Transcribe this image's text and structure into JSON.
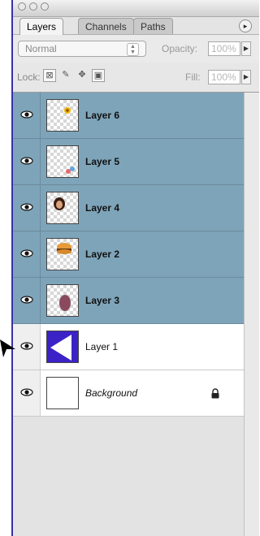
{
  "tabs": [
    {
      "label": "Layers",
      "active": true
    },
    {
      "label": "Channels",
      "active": false
    },
    {
      "label": "Paths",
      "active": false
    }
  ],
  "options": {
    "blend_mode": "Normal",
    "opacity_label": "Opacity:",
    "opacity_value": "100%",
    "lock_label": "Lock:",
    "fill_label": "Fill:",
    "fill_value": "100%"
  },
  "layers": [
    {
      "name": "Layer 6",
      "visible": true,
      "selected": true
    },
    {
      "name": "Layer 5",
      "visible": true,
      "selected": true
    },
    {
      "name": "Layer 4",
      "visible": true,
      "selected": true
    },
    {
      "name": "Layer 2",
      "visible": true,
      "selected": true
    },
    {
      "name": "Layer 3",
      "visible": true,
      "selected": true
    },
    {
      "name": "Layer 1",
      "visible": true,
      "selected": false
    },
    {
      "name": "Background",
      "visible": true,
      "selected": false,
      "locked": true
    }
  ],
  "colors": {
    "selection": "#7ea4b9",
    "layer1_fill": "#3b22c6"
  }
}
